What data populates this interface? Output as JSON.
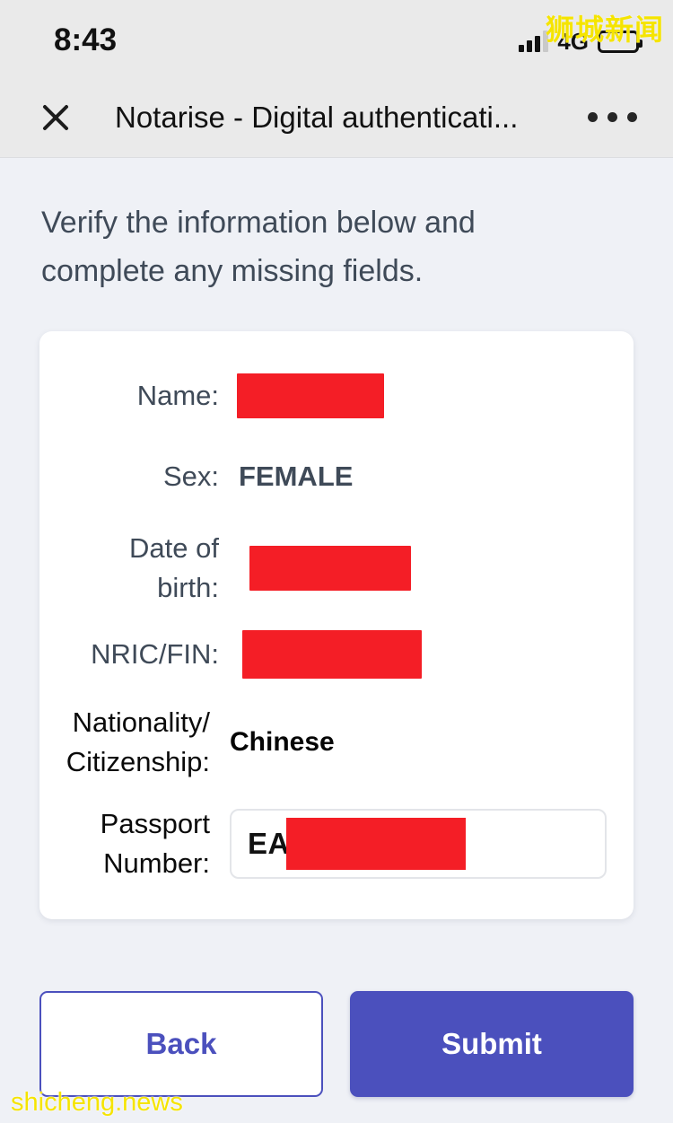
{
  "statusbar": {
    "time": "8:43",
    "network": "4G",
    "signal_icon": "signal-bars-icon",
    "battery_icon": "battery-full-icon"
  },
  "watermarks": {
    "top": "狮城新闻",
    "bottom": "shicheng.news",
    "color": "#f5e400"
  },
  "appbar": {
    "close_icon": "close-icon",
    "title": "Notarise - Digital authenticati...",
    "menu_icon": "more-options-icon"
  },
  "main": {
    "intro": "Verify the information below and complete any missing fields."
  },
  "form": {
    "rows": [
      {
        "label": "Name:",
        "value": "",
        "redacted": true
      },
      {
        "label": "Sex:",
        "value": "FEMALE",
        "redacted": false
      },
      {
        "label": "Date of birth:",
        "value": "",
        "redacted": true
      },
      {
        "label": "NRIC/FIN:",
        "value": "",
        "redacted": true
      },
      {
        "label": "Nationality/ Citizenship:",
        "value": "Chinese",
        "redacted": false
      },
      {
        "label": "Passport Number:",
        "value": "EA",
        "redacted": true
      }
    ],
    "labels": {
      "name": "Name:",
      "sex": "Sex:",
      "dob_line1": "Date of",
      "dob_line2": "birth:",
      "nric": "NRIC/FIN:",
      "nat_line1": "Nationality/",
      "nat_line2": "Citizenship:",
      "passport_line1": "Passport",
      "passport_line2": "Number:"
    },
    "values": {
      "sex": "FEMALE",
      "nationality": "Chinese",
      "passport_prefix": "EA"
    }
  },
  "buttons": {
    "back": "Back",
    "submit": "Submit",
    "accent": "#4b50bd"
  },
  "colors": {
    "page_bg": "#eff1f6",
    "chrome_bg": "#eaeaea",
    "card_bg": "#ffffff",
    "redaction": "#f41e26",
    "label_text": "#3f4a58"
  }
}
